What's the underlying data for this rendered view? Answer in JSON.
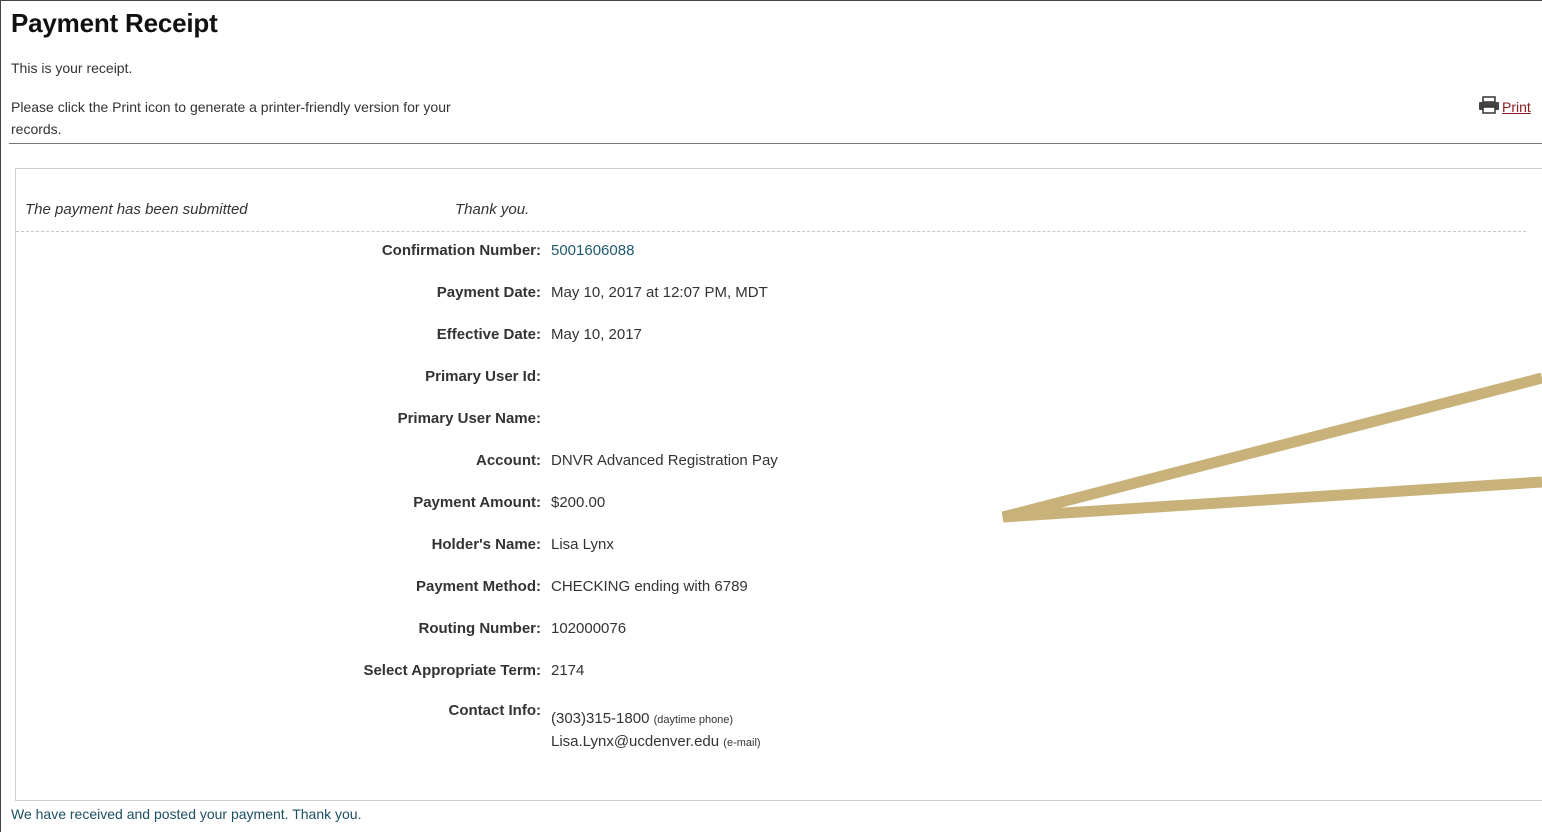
{
  "header": {
    "title": "Payment Receipt",
    "intro": "This is your receipt.",
    "print_instructions": "Please click the Print icon to generate a printer-friendly version for your records.",
    "print_label": "Print",
    "print_icon": "printer-icon"
  },
  "status": {
    "message": "The payment has been submitted",
    "thanks": "Thank you."
  },
  "details": {
    "confirmation_label": "Confirmation Number:",
    "confirmation_value": "5001606088",
    "payment_date_label": "Payment Date:",
    "payment_date_value": "May 10, 2017 at 12:07 PM, MDT",
    "effective_date_label": "Effective Date:",
    "effective_date_value": "May 10, 2017",
    "primary_user_id_label": "Primary User Id:",
    "primary_user_name_label": "Primary User Name:",
    "account_label": "Account:",
    "account_value": "DNVR Advanced Registration Pay",
    "amount_label": "Payment Amount:",
    "amount_value": "$200.00",
    "holder_label": "Holder's Name:",
    "holder_value": "Lisa Lynx",
    "method_label": "Payment Method:",
    "method_value": "CHECKING ending with 6789",
    "routing_label": "Routing Number:",
    "routing_value": "102000076",
    "term_label": "Select Appropriate Term:",
    "term_value": "2174",
    "contact_label": "Contact Info:",
    "phone_value": "(303)315-1800",
    "phone_note": "(daytime phone)",
    "email_value": "Lisa.Lynx@ucdenver.edu",
    "email_note": "(e-mail)"
  },
  "footer": {
    "message": "We have received and posted your payment. Thank you."
  },
  "colors": {
    "link": "#8b1a1a",
    "value_teal": "#1f5a6e",
    "annotation": "#c8b27a"
  }
}
